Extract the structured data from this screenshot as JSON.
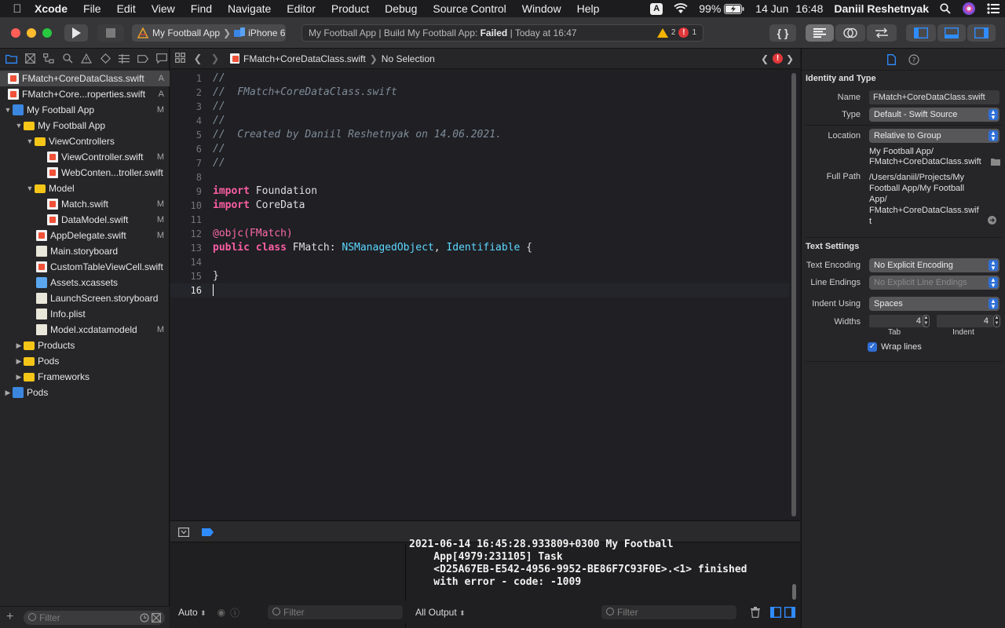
{
  "menubar": {
    "app": "Xcode",
    "items": [
      "File",
      "Edit",
      "View",
      "Find",
      "Navigate",
      "Editor",
      "Product",
      "Debug",
      "Source Control",
      "Window",
      "Help"
    ],
    "input_source": "A",
    "battery": "99%",
    "date": "14 Jun",
    "time": "16:48",
    "user": "Daniil Reshetnyak"
  },
  "toolbar": {
    "scheme": "My Football App",
    "device": "iPhone 6",
    "status_prefix": "My Football App | Build My Football App: ",
    "status_result": "Failed",
    "status_suffix": " | Today at 16:47",
    "warning_count": "2",
    "error_count": "1",
    "colors": {
      "close": "#ff5f57",
      "minimize": "#febc2e",
      "zoom": "#28c840"
    }
  },
  "navigator": {
    "items": [
      {
        "name": "FMatch+CoreDataClass.swift",
        "badge": "A"
      },
      {
        "name": "FMatch+Core...roperties.swift",
        "badge": "A"
      },
      {
        "name": "My Football App",
        "badge": "M"
      },
      {
        "name": "My Football App",
        "badge": ""
      },
      {
        "name": "ViewControllers",
        "badge": ""
      },
      {
        "name": "ViewController.swift",
        "badge": "M"
      },
      {
        "name": "WebConten...troller.swift",
        "badge": ""
      },
      {
        "name": "Model",
        "badge": ""
      },
      {
        "name": "Match.swift",
        "badge": "M"
      },
      {
        "name": "DataModel.swift",
        "badge": "M"
      },
      {
        "name": "AppDelegate.swift",
        "badge": "M"
      },
      {
        "name": "Main.storyboard",
        "badge": ""
      },
      {
        "name": "CustomTableViewCell.swift",
        "badge": ""
      },
      {
        "name": "Assets.xcassets",
        "badge": ""
      },
      {
        "name": "LaunchScreen.storyboard",
        "badge": ""
      },
      {
        "name": "Info.plist",
        "badge": ""
      },
      {
        "name": "Model.xcdatamodeld",
        "badge": "M"
      },
      {
        "name": "Products",
        "badge": ""
      },
      {
        "name": "Pods",
        "badge": ""
      },
      {
        "name": "Frameworks",
        "badge": ""
      },
      {
        "name": "Pods",
        "badge": ""
      }
    ],
    "filter_placeholder": "Filter"
  },
  "jumpbar": {
    "file": "FMatch+CoreDataClass.swift",
    "selection": "No Selection"
  },
  "editor": {
    "lines": [
      "//",
      "//  FMatch+CoreDataClass.swift",
      "//",
      "//",
      "//  Created by Daniil Reshetnyak on 14.06.2021.",
      "//",
      "//",
      "",
      "import Foundation",
      "import CoreData",
      "",
      "@objc(FMatch)",
      "public class FMatch: NSManagedObject, Identifiable {",
      "",
      "}",
      ""
    ],
    "current_line": "16"
  },
  "debug": {
    "variables_scope": "Auto",
    "output_scope": "All Output",
    "filter_placeholder": "Filter",
    "console_text": "2021-06-14 16:45:28.933809+0300 My Football\n    App[4979:231105] Task\n    <D25A67EB-E542-4956-9952-BE86F7C93F0E>.<1> finished\n    with error - code: -1009"
  },
  "inspector": {
    "identity_title": "Identity and Type",
    "name_label": "Name",
    "name_value": "FMatch+CoreDataClass.swift",
    "type_label": "Type",
    "type_value": "Default - Swift Source",
    "location_label": "Location",
    "location_value": "Relative to Group",
    "location_path_1": "My Football App/",
    "location_path_2": "FMatch+CoreDataClass.swift",
    "fullpath_label": "Full Path",
    "fullpath_lines": [
      "/Users/daniil/Projects/My",
      "Football App/My Football",
      "App/",
      "FMatch+CoreDataClass.swif",
      "t"
    ],
    "text_settings_title": "Text Settings",
    "encoding_label": "Text Encoding",
    "encoding_value": "No Explicit Encoding",
    "endings_label": "Line Endings",
    "endings_value": "No Explicit Line Endings",
    "indent_label": "Indent Using",
    "indent_value": "Spaces",
    "widths_label": "Widths",
    "tab_width": "4",
    "indent_width": "4",
    "tab_label": "Tab",
    "indent_sub_label": "Indent",
    "wrap_label": "Wrap lines"
  }
}
